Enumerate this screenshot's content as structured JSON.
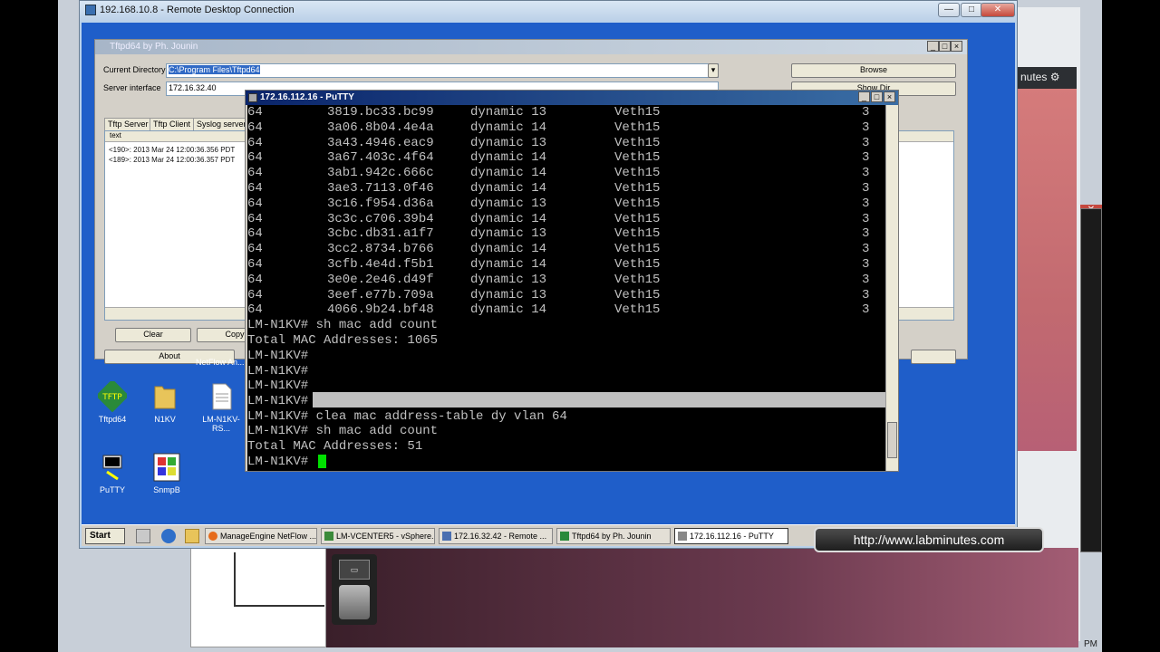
{
  "rdp": {
    "title": "192.168.10.8 - Remote Desktop Connection",
    "btn_min": "—",
    "btn_max": "□",
    "btn_close": "✕"
  },
  "host": {
    "strip_text": "nutes ⚙",
    "clock": "PM",
    "side_close": "✕"
  },
  "tftpd": {
    "title": "Tftpd64 by Ph. Jounin",
    "current_dir_label": "Current Directory",
    "current_dir_value": "C:\\Program Files\\Tftpd64",
    "server_iface_label": "Server interface",
    "server_iface_value": "172.16.32.40",
    "browse_label": "Browse",
    "show_dir_label": "Show Dir",
    "tabs": [
      "Tftp Server",
      "Tftp Client",
      "Syslog server"
    ],
    "list_header": "text",
    "log_lines": [
      "<190>: 2013 Mar 24 12:00:36.356 PDT",
      "<189>: 2013 Mar 24 12:00:36.357 PDT"
    ],
    "clear_label": "Clear",
    "copy_label": "Copy",
    "about_label": "About"
  },
  "desktop": {
    "netflow_label": "NetFlow An...",
    "icons": [
      "Tftpd64",
      "N1KV",
      "LM-N1KV-RS...",
      "PuTTY",
      "SnmpB"
    ]
  },
  "taskbar": {
    "start_label": "Start",
    "tasks": [
      "ManageEngine NetFlow ...",
      "LM-VCENTER5 - vSphere...",
      "172.16.32.42 - Remote ...",
      "Tftpd64 by Ph. Jounin",
      "172.16.112.16 - PuTTY"
    ]
  },
  "putty": {
    "title": "172.16.112.16 - PuTTY",
    "mac_rows": [
      [
        "64",
        "3819.bc33.bc99",
        "dynamic 13",
        "Veth15",
        "3"
      ],
      [
        "64",
        "3a06.8b04.4e4a",
        "dynamic 14",
        "Veth15",
        "3"
      ],
      [
        "64",
        "3a43.4946.eac9",
        "dynamic 13",
        "Veth15",
        "3"
      ],
      [
        "64",
        "3a67.403c.4f64",
        "dynamic 14",
        "Veth15",
        "3"
      ],
      [
        "64",
        "3ab1.942c.666c",
        "dynamic 14",
        "Veth15",
        "3"
      ],
      [
        "64",
        "3ae3.7113.0f46",
        "dynamic 14",
        "Veth15",
        "3"
      ],
      [
        "64",
        "3c16.f954.d36a",
        "dynamic 13",
        "Veth15",
        "3"
      ],
      [
        "64",
        "3c3c.c706.39b4",
        "dynamic 14",
        "Veth15",
        "3"
      ],
      [
        "64",
        "3cbc.db31.a1f7",
        "dynamic 13",
        "Veth15",
        "3"
      ],
      [
        "64",
        "3cc2.8734.b766",
        "dynamic 14",
        "Veth15",
        "3"
      ],
      [
        "64",
        "3cfb.4e4d.f5b1",
        "dynamic 14",
        "Veth15",
        "3"
      ],
      [
        "64",
        "3e0e.2e46.d49f",
        "dynamic 13",
        "Veth15",
        "3"
      ],
      [
        "64",
        "3eef.e77b.709a",
        "dynamic 13",
        "Veth15",
        "3"
      ],
      [
        "64",
        "4066.9b24.bf48",
        "dynamic 14",
        "Veth15",
        "3"
      ]
    ],
    "lines": [
      "LM-N1KV# sh mac add count",
      "Total MAC Addresses: 1065",
      "LM-N1KV#",
      "LM-N1KV#",
      "LM-N1KV#",
      "LM-N1KV#",
      "LM-N1KV# clea mac address-table dy vlan 64",
      "LM-N1KV# sh mac add count",
      "Total MAC Addresses: 51",
      "LM-N1KV# "
    ]
  },
  "watermark": "http://www.labminutes.com"
}
